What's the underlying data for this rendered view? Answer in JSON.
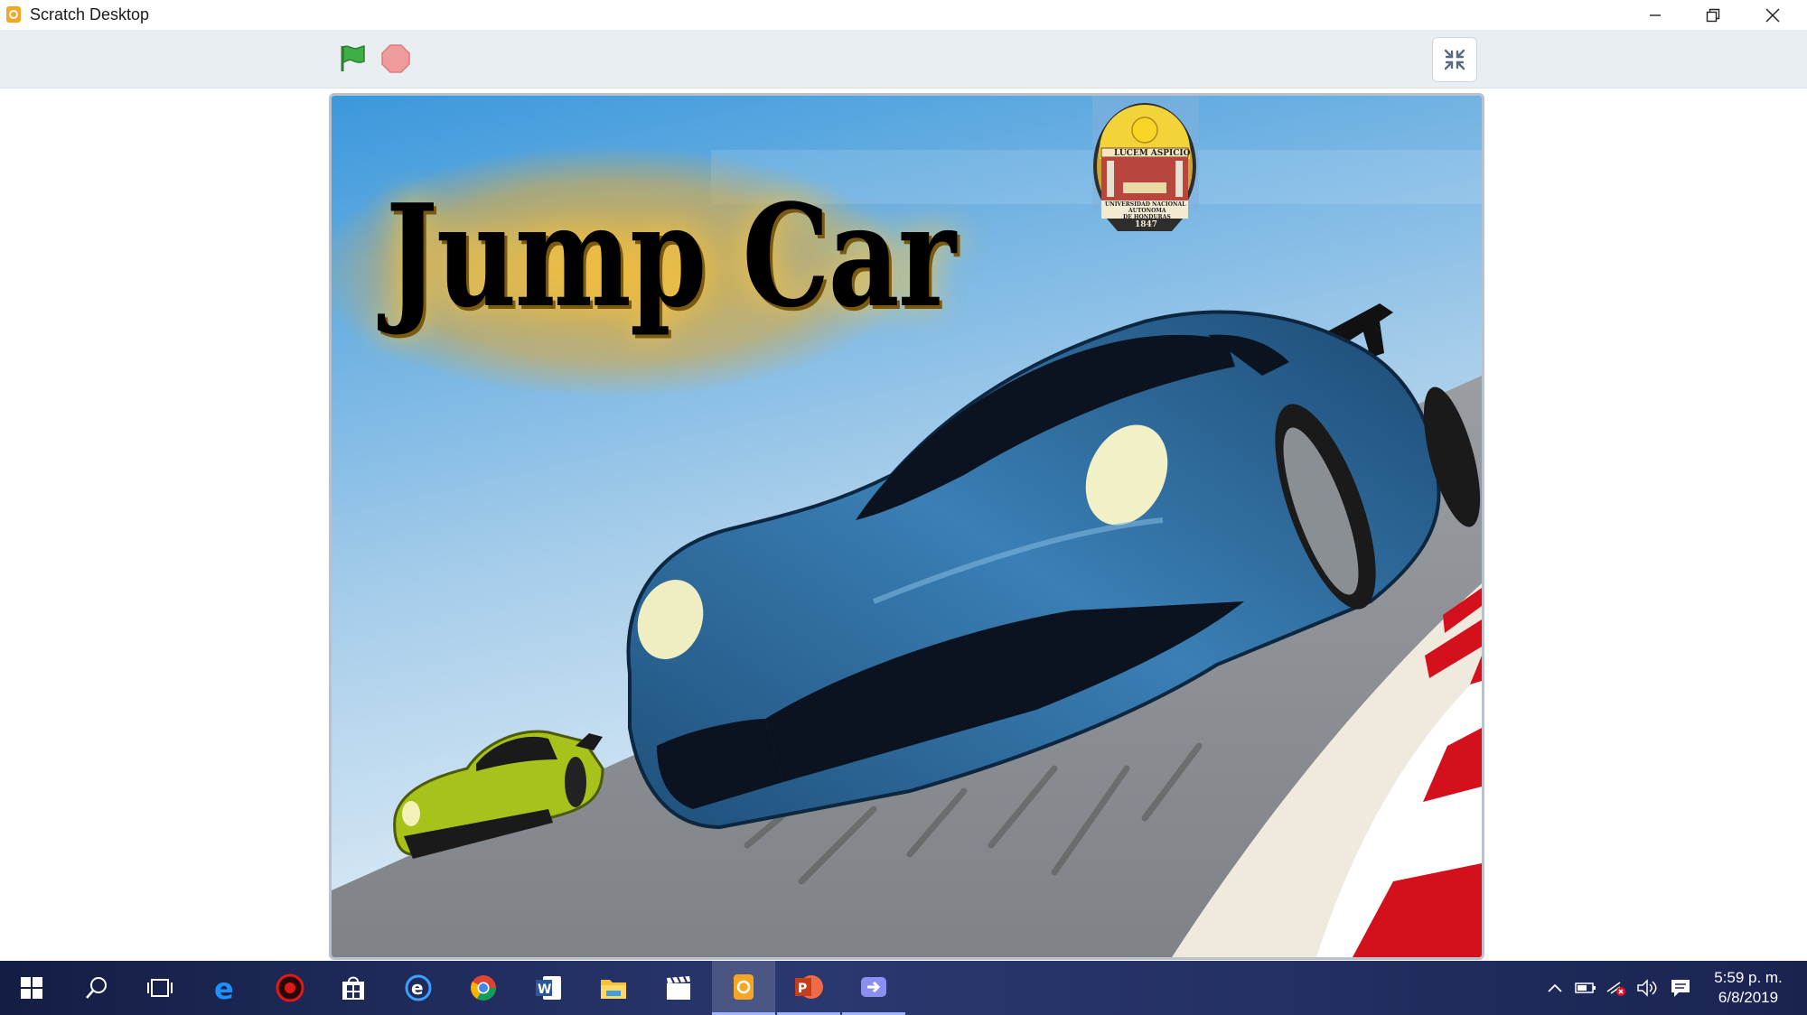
{
  "window": {
    "title": "Scratch Desktop",
    "controls": [
      "minimize",
      "restore",
      "close"
    ]
  },
  "toolbar": {
    "green_flag_icon": "green-flag-icon",
    "stop_icon": "stop-icon",
    "fullscreen_exit_icon": "exit-fullscreen-icon"
  },
  "stage": {
    "game_title": "Jump Car",
    "seal": {
      "motto": "LUCEM ASPICIO",
      "name_line1": "UNIVERSIDAD NACIONAL",
      "name_line2": "AUTONOMA",
      "name_line3": "DE HONDURAS",
      "year": "1847"
    },
    "colors": {
      "sky_top": "#4aa3df",
      "sky_bottom": "#dbeaf6",
      "road": "#8f9397",
      "car_main": "#2f6f9f",
      "car_small": "#a8c21c",
      "curb_red": "#d4101c"
    }
  },
  "taskbar": {
    "icons": [
      "windows-start-icon",
      "search-icon",
      "task-view-icon",
      "edge-icon",
      "red-app-icon",
      "store-icon",
      "cortana-edge-icon",
      "chrome-icon",
      "word-icon",
      "file-explorer-icon",
      "video-editor-icon",
      "scratch-icon",
      "powerpoint-icon",
      "connect-app-icon"
    ],
    "active": "scratch-icon",
    "tray_icons": [
      "chevron-up-icon",
      "battery-icon",
      "network-icon",
      "volume-icon",
      "notifications-icon"
    ],
    "time": "5:59 p. m.",
    "date": "6/8/2019"
  }
}
